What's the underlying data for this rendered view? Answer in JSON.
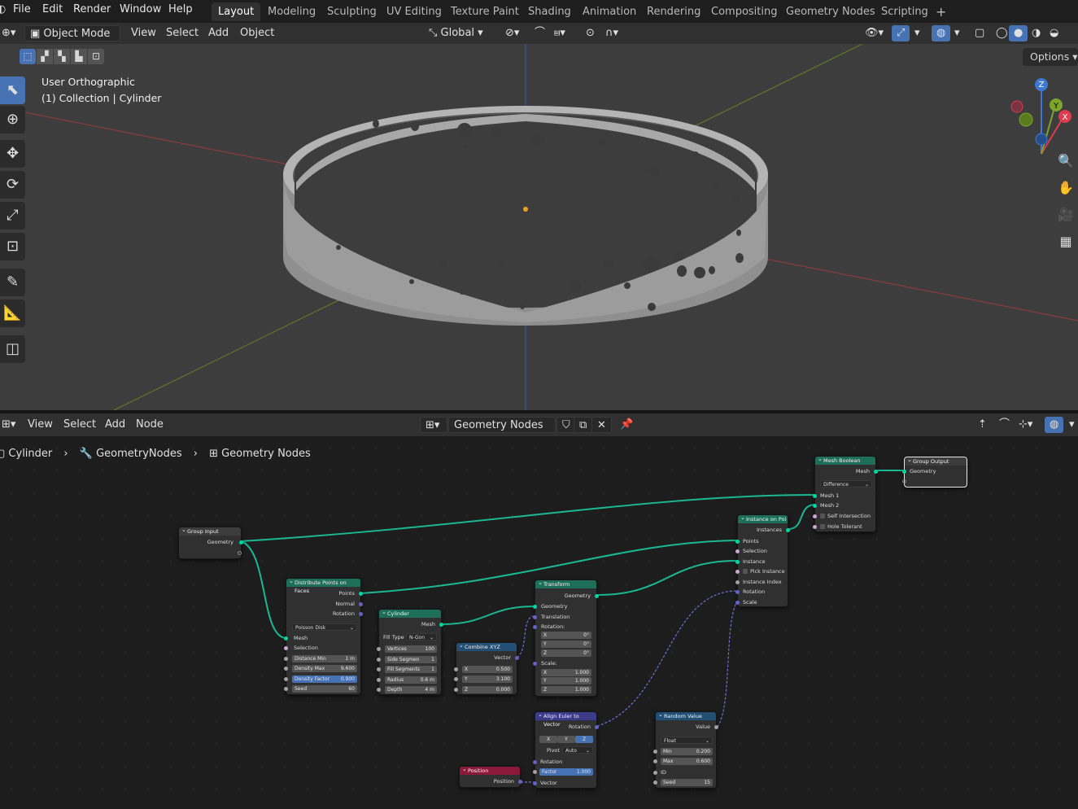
{
  "menu": {
    "file": "File",
    "edit": "Edit",
    "render": "Render",
    "window": "Window",
    "help": "Help"
  },
  "workspaces": [
    "Layout",
    "Modeling",
    "Sculpting",
    "UV Editing",
    "Texture Paint",
    "Shading",
    "Animation",
    "Rendering",
    "Compositing",
    "Geometry Nodes",
    "Scripting"
  ],
  "viewport_header": {
    "mode": "Object Mode",
    "view": "View",
    "select": "Select",
    "add": "Add",
    "object": "Object",
    "orientation": "Global",
    "options": "Options"
  },
  "viewport": {
    "view_name": "User Orthographic",
    "collection": "(1) Collection | Cylinder"
  },
  "gizmo": {
    "x": "X",
    "y": "Y",
    "z": "Z"
  },
  "node_header": {
    "view": "View",
    "select": "Select",
    "add": "Add",
    "node": "Node",
    "tree": "Geometry Nodes"
  },
  "breadcrumb": {
    "object": "Cylinder",
    "modifier": "GeometryNodes",
    "tree": "Geometry Nodes"
  },
  "nodes": {
    "group_input": {
      "title": "Group Input",
      "geometry": "Geometry"
    },
    "distribute": {
      "title": "Distribute Points on Faces",
      "points": "Points",
      "normal": "Normal",
      "rotation": "Rotation",
      "method": "Poisson Disk",
      "mesh": "Mesh",
      "selection": "Selection",
      "dist_min_label": "Distance Min",
      "dist_min": "1 m",
      "density_max_label": "Density Max",
      "density_max": "9.600",
      "density_factor_label": "Density Factor",
      "density_factor": "0.900",
      "seed_label": "Seed",
      "seed": "60"
    },
    "cylinder": {
      "title": "Cylinder",
      "mesh": "Mesh",
      "fill_label": "Fill Type",
      "fill": "N-Gon",
      "vertices_label": "Vertices",
      "vertices": "100",
      "side_label": "Side Segmen",
      "side": "1",
      "fill_seg_label": "Fill Segments",
      "fill_seg": "1",
      "radius_label": "Radius",
      "radius": "0.6 m",
      "depth_label": "Depth",
      "depth": "4 m"
    },
    "combine": {
      "title": "Combine XYZ",
      "vector": "Vector",
      "x": "0.500",
      "y": "3.100",
      "z": "0.000"
    },
    "transform": {
      "title": "Transform",
      "geometry": "Geometry",
      "geometry_in": "Geometry",
      "translation": "Translation",
      "rotation": "Rotation:",
      "rx": "0°",
      "ry": "0°",
      "rz": "0°",
      "scale": "Scale:",
      "sx": "1.000",
      "sy": "1.000",
      "sz": "1.000"
    },
    "instance": {
      "title": "Instance on Poi",
      "instances": "Instances",
      "points": "Points",
      "selection": "Selection",
      "instance": "Instance",
      "pick": "Pick Instance",
      "index": "Instance Index",
      "rotation": "Rotation",
      "scale": "Scale"
    },
    "boolean": {
      "title": "Mesh Boolean",
      "mesh": "Mesh",
      "op": "Difference",
      "mesh1": "Mesh 1",
      "mesh2": "Mesh 2",
      "self": "Self Intersection",
      "hole": "Hole Tolerant"
    },
    "group_output": {
      "title": "Group Output",
      "geometry": "Geometry"
    },
    "align": {
      "title": "Align Euler to Vector",
      "rotation": "Rotation",
      "x": "X",
      "y": "Y",
      "z": "Z",
      "pivot_label": "Pivot",
      "pivot": "Auto",
      "rot_in": "Rotation",
      "factor_label": "Factor",
      "factor": "1.000",
      "vector": "Vector"
    },
    "position": {
      "title": "Position",
      "position": "Position"
    },
    "random": {
      "title": "Random Value",
      "value": "Value",
      "type": "Float",
      "min_label": "Min",
      "min": "0.200",
      "max_label": "Max",
      "max": "0.600",
      "id": "ID",
      "seed_label": "Seed",
      "seed": "15"
    }
  },
  "colors": {
    "accent": "#4772b3",
    "geometry_socket": "#00d6a3",
    "vector_socket": "#6363c7"
  }
}
